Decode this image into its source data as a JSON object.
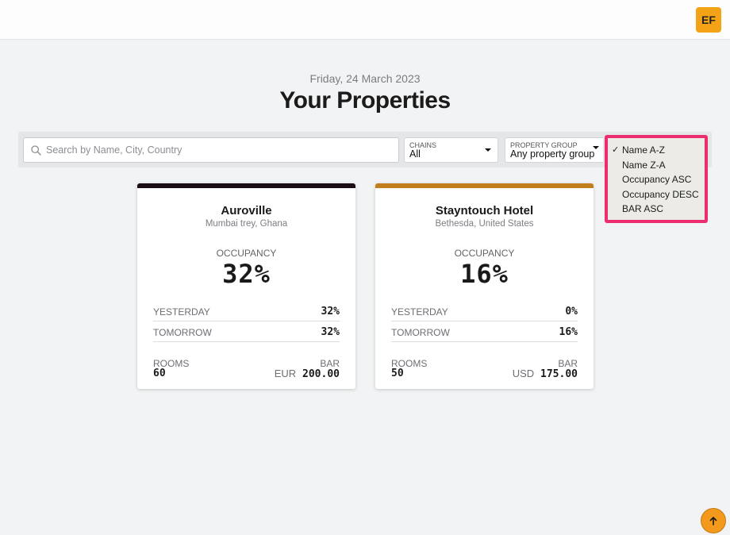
{
  "header": {
    "avatar_initials": "EF",
    "avatar_color": "#f5a316"
  },
  "page": {
    "date": "Friday, 24 March 2023",
    "title": "Your Properties"
  },
  "filters": {
    "search_placeholder": "Search by Name, City, Country",
    "search_value": "",
    "chains": {
      "label": "CHAINS",
      "value": "All"
    },
    "property_group": {
      "label": "PROPERTY GROUP",
      "value": "Any property group"
    }
  },
  "sort_menu": {
    "highlight_color": "#ec2d6f",
    "selected": "Name A-Z",
    "check": "✓",
    "options": [
      "Name A-Z",
      "Name Z-A",
      "Occupancy ASC",
      "Occupancy DESC",
      "BAR ASC"
    ]
  },
  "properties": [
    {
      "name": "Auroville",
      "location": "Mumbai trey, Ghana",
      "band_color": "#1a0d14",
      "occupancy_label": "OCCUPANCY",
      "occupancy": "32%",
      "yesterday_label": "YESTERDAY",
      "yesterday": "32%",
      "tomorrow_label": "TOMORROW",
      "tomorrow": "32%",
      "rooms_label": "ROOMS",
      "rooms": "60",
      "bar_label": "BAR",
      "bar_currency": "EUR",
      "bar_value": "200.00"
    },
    {
      "name": "Stayntouch Hotel",
      "location": "Bethesda, United States",
      "band_color": "#c07f1c",
      "occupancy_label": "OCCUPANCY",
      "occupancy": "16%",
      "yesterday_label": "YESTERDAY",
      "yesterday": "0%",
      "tomorrow_label": "TOMORROW",
      "tomorrow": "16%",
      "rooms_label": "ROOMS",
      "rooms": "50",
      "bar_label": "BAR",
      "bar_currency": "USD",
      "bar_value": "175.00"
    }
  ],
  "scroll_top": {
    "icon": "arrow-up-icon",
    "color": "#f39a1c"
  }
}
